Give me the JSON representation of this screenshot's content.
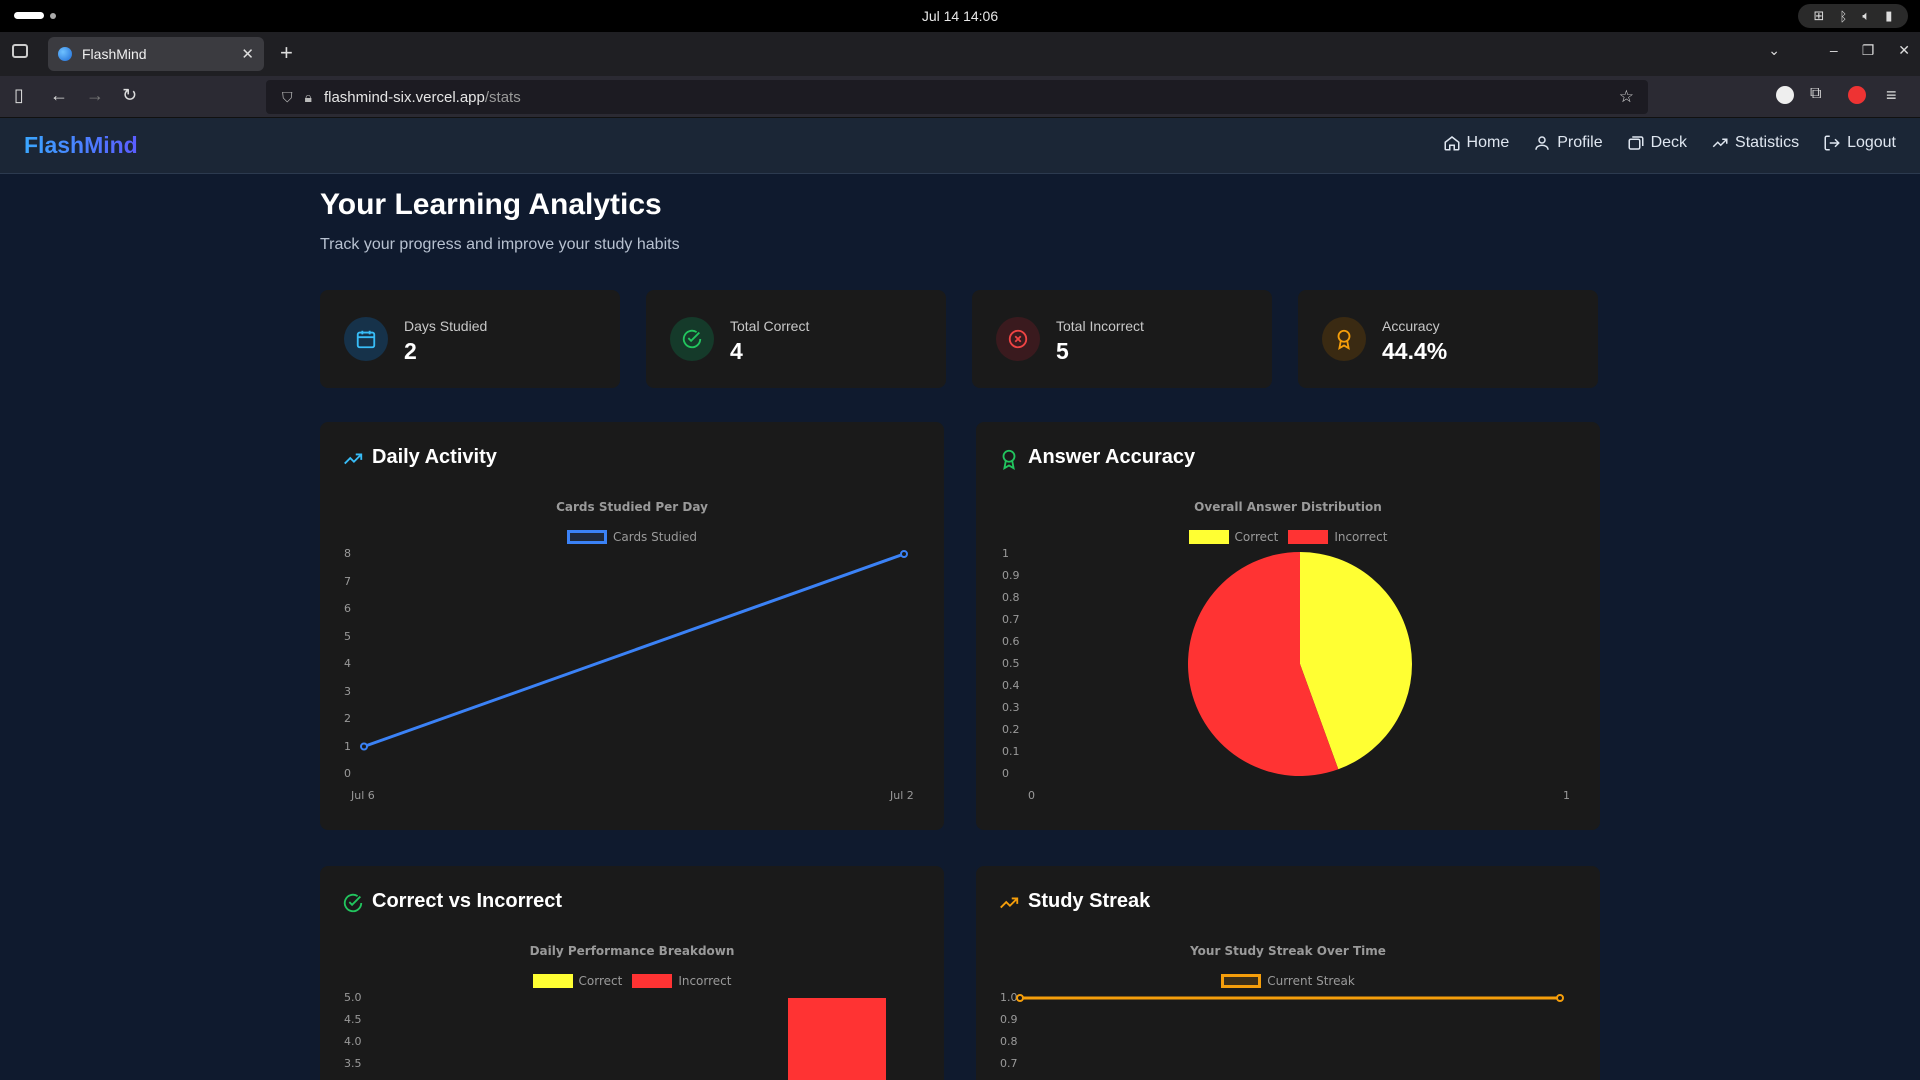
{
  "os": {
    "datetime": "Jul 14  14:06"
  },
  "browser": {
    "tab_title": "FlashMind",
    "url_host": "flashmind-six.vercel.app",
    "url_path": "/stats"
  },
  "app": {
    "brand": "FlashMind",
    "nav": [
      {
        "label": "Home",
        "icon": "home-icon"
      },
      {
        "label": "Profile",
        "icon": "user-icon"
      },
      {
        "label": "Deck",
        "icon": "deck-icon"
      },
      {
        "label": "Statistics",
        "icon": "trending-up-icon"
      },
      {
        "label": "Logout",
        "icon": "logout-icon"
      }
    ]
  },
  "page": {
    "title": "Your Learning Analytics",
    "subtitle": "Track your progress and improve your study habits"
  },
  "stats": [
    {
      "label": "Days Studied",
      "value": "2",
      "icon": "calendar-icon",
      "color": "#38bdf8"
    },
    {
      "label": "Total Correct",
      "value": "4",
      "icon": "check-circle-icon",
      "color": "#22c55e"
    },
    {
      "label": "Total Incorrect",
      "value": "5",
      "icon": "x-circle-icon",
      "color": "#ef4444"
    },
    {
      "label": "Accuracy",
      "value": "44.4%",
      "icon": "award-icon",
      "color": "#f59e0b"
    }
  ],
  "panels": {
    "daily": {
      "title": "Daily Activity"
    },
    "accuracy": {
      "title": "Answer Accuracy"
    },
    "correct_incorrect": {
      "title": "Correct vs Incorrect"
    },
    "streak": {
      "title": "Study Streak"
    }
  },
  "chart_data": [
    {
      "type": "line",
      "title": "Cards Studied Per Day",
      "categories": [
        "Jul 6",
        "Jul 2"
      ],
      "series": [
        {
          "name": "Cards Studied",
          "values": [
            1,
            8
          ],
          "color": "#3b82f6"
        }
      ],
      "ylim": [
        0,
        8
      ],
      "yticks": [
        "0",
        "1",
        "2",
        "3",
        "4",
        "5",
        "6",
        "7",
        "8"
      ],
      "legend": "top"
    },
    {
      "type": "pie",
      "title": "Overall Answer Distribution",
      "labels": [
        "Correct",
        "Incorrect"
      ],
      "values": [
        4,
        5
      ],
      "colors": [
        "#ffff33",
        "#ff3333"
      ],
      "yticks": [
        "0",
        "0.1",
        "0.2",
        "0.3",
        "0.4",
        "0.5",
        "0.6",
        "0.7",
        "0.8",
        "0.9",
        "1"
      ],
      "xticks": [
        "0",
        "1"
      ],
      "legend": "top"
    },
    {
      "type": "bar",
      "title": "Daily Performance Breakdown",
      "series": [
        {
          "name": "Correct",
          "color": "#ffff33"
        },
        {
          "name": "Incorrect",
          "color": "#ff3333"
        }
      ],
      "yticks_visible": [
        "5.0",
        "4.5",
        "4.0",
        "3.5"
      ],
      "ylim_visible": [
        3.5,
        5.0
      ],
      "visible_bar": {
        "series": "Incorrect",
        "value": 5
      },
      "legend": "top"
    },
    {
      "type": "line",
      "title": "Your Study Streak Over Time",
      "series": [
        {
          "name": "Current Streak",
          "values": [
            1,
            1
          ],
          "color": "#f59e0b"
        }
      ],
      "yticks_visible": [
        "1.0",
        "0.9",
        "0.8",
        "0.7"
      ],
      "legend": "top"
    }
  ]
}
